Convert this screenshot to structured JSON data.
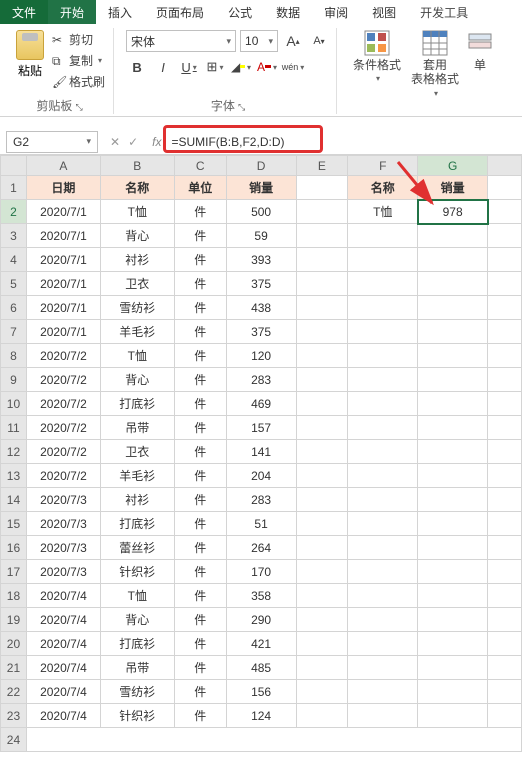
{
  "tabs": {
    "file": "文件",
    "start": "开始",
    "insert": "插入",
    "layout": "页面布局",
    "formula": "公式",
    "data": "数据",
    "review": "审阅",
    "view": "视图",
    "dev": "开发工具"
  },
  "clipboard": {
    "paste": "粘贴",
    "cut": "剪切",
    "copy": "复制",
    "brush": "格式刷",
    "group": "剪贴板"
  },
  "font": {
    "name": "宋体",
    "size": "10",
    "group": "字体"
  },
  "styles": {
    "cond": "条件格式",
    "table": "套用\n表格格式"
  },
  "cell_ref": "G2",
  "formula": "=SUMIF(B:B,F2,D:D)",
  "fx": "fx",
  "cols": [
    "A",
    "B",
    "C",
    "D",
    "E",
    "F",
    "G"
  ],
  "headers": {
    "date": "日期",
    "name": "名称",
    "unit": "单位",
    "qty": "销量"
  },
  "side": {
    "name": "名称",
    "qty": "销量",
    "item": "T恤",
    "sum": "978"
  },
  "rows": [
    {
      "d": "2020/7/1",
      "n": "T恤",
      "u": "件",
      "q": "500"
    },
    {
      "d": "2020/7/1",
      "n": "背心",
      "u": "件",
      "q": "59"
    },
    {
      "d": "2020/7/1",
      "n": "衬衫",
      "u": "件",
      "q": "393"
    },
    {
      "d": "2020/7/1",
      "n": "卫衣",
      "u": "件",
      "q": "375"
    },
    {
      "d": "2020/7/1",
      "n": "雪纺衫",
      "u": "件",
      "q": "438"
    },
    {
      "d": "2020/7/1",
      "n": "羊毛衫",
      "u": "件",
      "q": "375"
    },
    {
      "d": "2020/7/2",
      "n": "T恤",
      "u": "件",
      "q": "120"
    },
    {
      "d": "2020/7/2",
      "n": "背心",
      "u": "件",
      "q": "283"
    },
    {
      "d": "2020/7/2",
      "n": "打底衫",
      "u": "件",
      "q": "469"
    },
    {
      "d": "2020/7/2",
      "n": "吊带",
      "u": "件",
      "q": "157"
    },
    {
      "d": "2020/7/2",
      "n": "卫衣",
      "u": "件",
      "q": "141"
    },
    {
      "d": "2020/7/2",
      "n": "羊毛衫",
      "u": "件",
      "q": "204"
    },
    {
      "d": "2020/7/3",
      "n": "衬衫",
      "u": "件",
      "q": "283"
    },
    {
      "d": "2020/7/3",
      "n": "打底衫",
      "u": "件",
      "q": "51"
    },
    {
      "d": "2020/7/3",
      "n": "蕾丝衫",
      "u": "件",
      "q": "264"
    },
    {
      "d": "2020/7/3",
      "n": "针织衫",
      "u": "件",
      "q": "170"
    },
    {
      "d": "2020/7/4",
      "n": "T恤",
      "u": "件",
      "q": "358"
    },
    {
      "d": "2020/7/4",
      "n": "背心",
      "u": "件",
      "q": "290"
    },
    {
      "d": "2020/7/4",
      "n": "打底衫",
      "u": "件",
      "q": "421"
    },
    {
      "d": "2020/7/4",
      "n": "吊带",
      "u": "件",
      "q": "485"
    },
    {
      "d": "2020/7/4",
      "n": "雪纺衫",
      "u": "件",
      "q": "156"
    },
    {
      "d": "2020/7/4",
      "n": "针织衫",
      "u": "件",
      "q": "124"
    }
  ]
}
